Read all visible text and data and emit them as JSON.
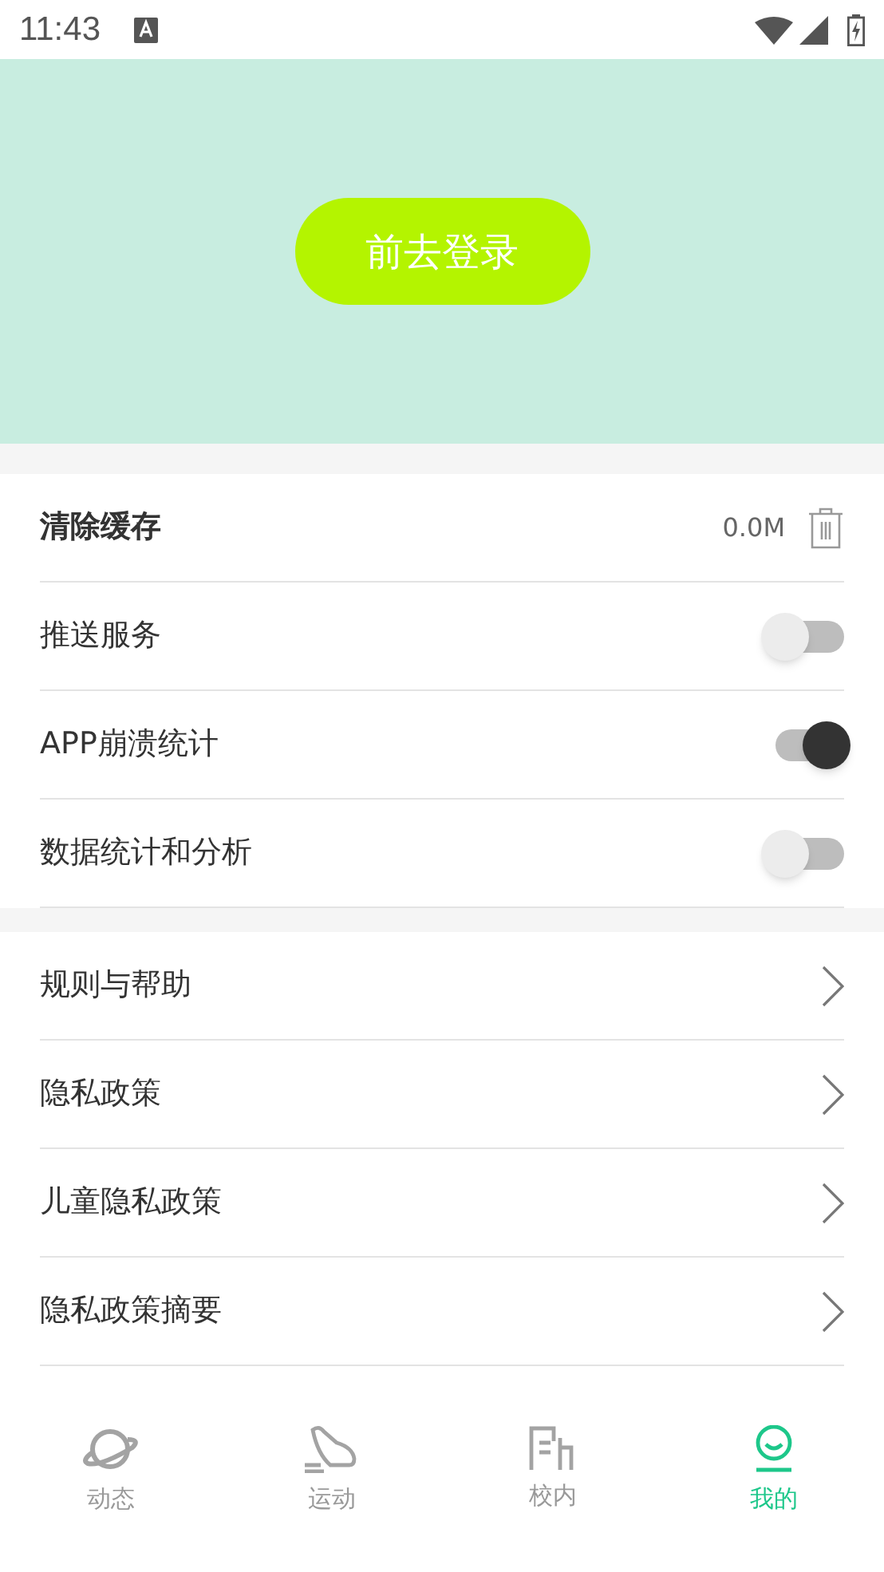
{
  "status_bar": {
    "time": "11:43"
  },
  "header": {
    "login_button": "前去登录"
  },
  "settings": [
    {
      "kind": "cache",
      "label": "清除缓存",
      "value": "0.0M"
    },
    {
      "kind": "switch",
      "label": "推送服务",
      "on": false
    },
    {
      "kind": "switch",
      "label": "APP崩溃统计",
      "on": true
    },
    {
      "kind": "switch",
      "label": "数据统计和分析",
      "on": false
    }
  ],
  "links": [
    {
      "label": "规则与帮助"
    },
    {
      "label": "隐私政策"
    },
    {
      "label": "儿童隐私政策"
    },
    {
      "label": "隐私政策摘要"
    }
  ],
  "tab_bar": [
    {
      "label": "动态",
      "kind": "planet",
      "selected": false
    },
    {
      "label": "运动",
      "kind": "shoe",
      "selected": false
    },
    {
      "label": "校内",
      "kind": "doc",
      "selected": false
    },
    {
      "label": "我的",
      "kind": "person",
      "selected": true
    }
  ]
}
